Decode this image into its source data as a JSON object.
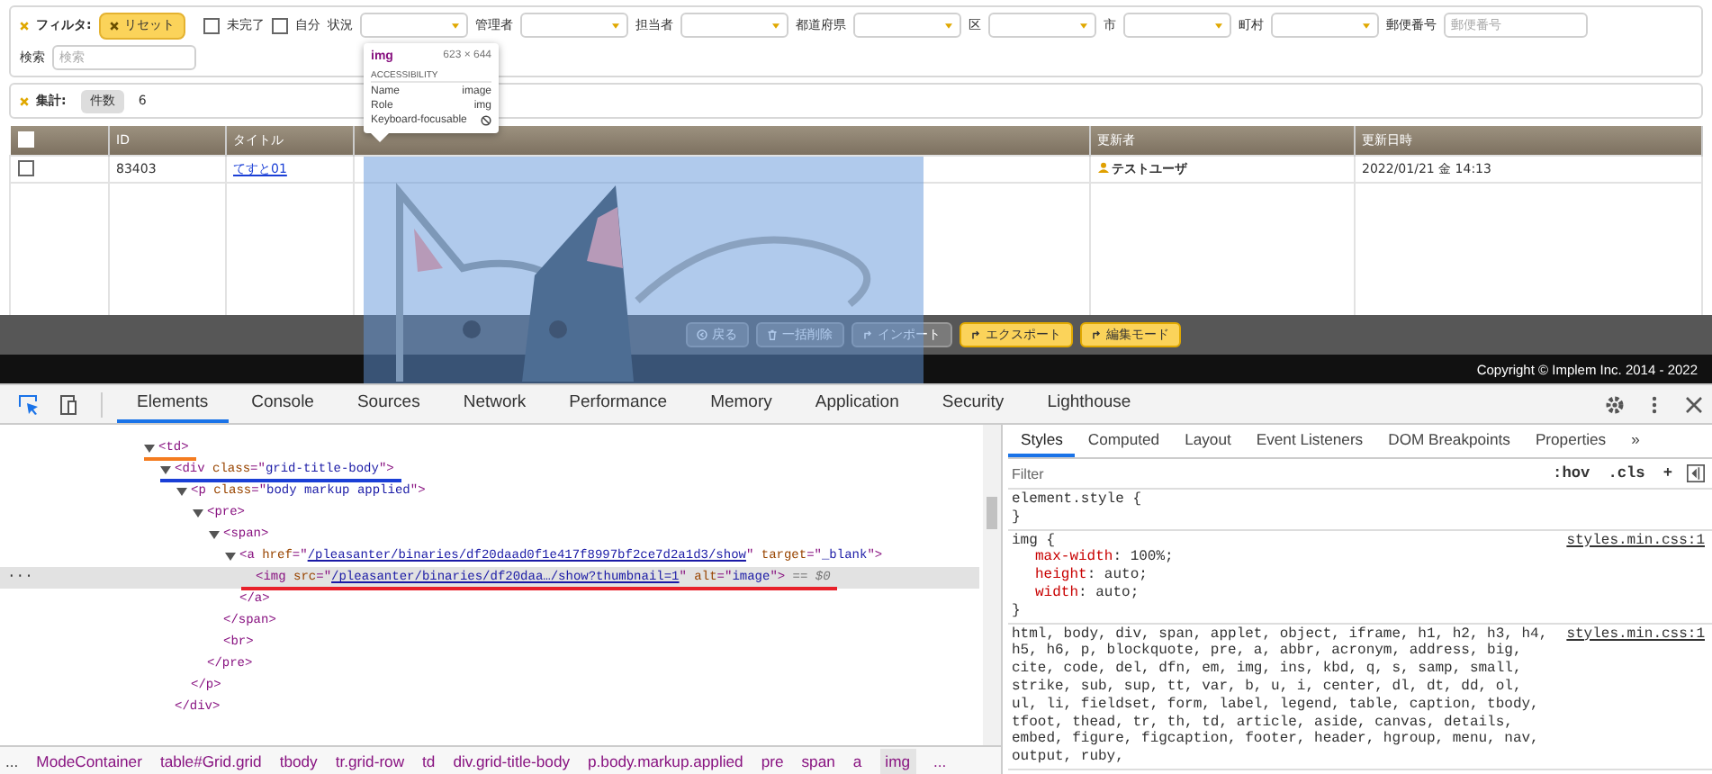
{
  "filter": {
    "label": "フィルタ:",
    "reset": "リセット",
    "checks": [
      {
        "label": "未完了",
        "checked": false
      },
      {
        "label": "自分",
        "checked": false
      }
    ],
    "selects": [
      {
        "label": "状況"
      },
      {
        "label": "管理者"
      },
      {
        "label": "担当者"
      },
      {
        "label": "都道府県"
      },
      {
        "label": "区"
      },
      {
        "label": "市"
      },
      {
        "label": "町村"
      }
    ],
    "postal": {
      "label": "郵便番号",
      "placeholder": "郵便番号"
    },
    "search": {
      "label": "検索",
      "placeholder": "検索"
    }
  },
  "summary": {
    "label": "集計:",
    "button": "件数",
    "value": "6"
  },
  "table": {
    "header_checked": false,
    "columns": [
      {
        "label": "ID"
      },
      {
        "label": "タイトル"
      },
      {},
      {
        "label": "更新者"
      },
      {
        "label": "更新日時"
      }
    ],
    "rows": [
      {
        "checked": false,
        "id": "83403",
        "title": "てすと01",
        "updated_by": "テストユーザ",
        "updated_at": "2022/01/21 金 14:13"
      }
    ]
  },
  "command_bar": [
    {
      "label": "戻る",
      "disabled": true
    },
    {
      "label": "一括削除",
      "disabled": true
    },
    {
      "label": "インポート",
      "disabled": true
    },
    {
      "label": "エクスポート",
      "disabled": false
    },
    {
      "label": "編集モード",
      "disabled": false
    }
  ],
  "footer": "Copyright © Implem Inc. 2014 - 2022",
  "tooltip": {
    "tag": "img",
    "size": "623 × 644",
    "section": "ACCESSIBILITY",
    "rows": [
      {
        "label": "Name",
        "value": "image"
      },
      {
        "label": "Role",
        "value": "img"
      },
      {
        "label": "Keyboard-focusable"
      }
    ]
  },
  "devtools": {
    "inspect_on": true,
    "tabs": [
      {
        "label": "Elements",
        "selected": true
      },
      {
        "label": "Console",
        "selected": false
      },
      {
        "label": "Sources",
        "selected": false
      },
      {
        "label": "Network",
        "selected": false
      },
      {
        "label": "Performance",
        "selected": false
      },
      {
        "label": "Memory",
        "selected": false
      },
      {
        "label": "Application",
        "selected": false
      },
      {
        "label": "Security",
        "selected": false
      },
      {
        "label": "Lighthouse",
        "selected": false
      }
    ],
    "row_menu": "···",
    "elements_tree": [
      {
        "open": [
          {
            "kind": "tag",
            "text": "<td>"
          }
        ],
        "expanded": true,
        "selected": false,
        "color": "#f47c20",
        "children": [
          {
            "open": [
              {
                "kind": "tag",
                "text": "<div"
              },
              {
                "kind": "attr",
                "text": " class"
              },
              {
                "kind": "punct",
                "text": "=\""
              },
              {
                "kind": "value",
                "text": "grid-title-body"
              },
              {
                "kind": "punct",
                "text": "\""
              },
              {
                "kind": "tag",
                "text": ">"
              }
            ],
            "expanded": true,
            "selected": false,
            "color": "#1a3fd6",
            "children": [
              {
                "open": [
                  {
                    "kind": "tag",
                    "text": "<p"
                  },
                  {
                    "kind": "attr",
                    "text": " class"
                  },
                  {
                    "kind": "punct",
                    "text": "=\""
                  },
                  {
                    "kind": "value",
                    "text": "body markup applied"
                  },
                  {
                    "kind": "punct",
                    "text": "\""
                  },
                  {
                    "kind": "tag",
                    "text": ">"
                  }
                ],
                "expanded": true,
                "selected": false,
                "children": [
                  {
                    "open": [
                      {
                        "kind": "tag",
                        "text": "<pre>"
                      }
                    ],
                    "expanded": true,
                    "selected": false,
                    "children": [
                      {
                        "open": [
                          {
                            "kind": "tag",
                            "text": "<span>"
                          }
                        ],
                        "expanded": true,
                        "selected": false,
                        "children": [
                          {
                            "open": [
                              {
                                "kind": "tag",
                                "text": "<a"
                              },
                              {
                                "kind": "attr",
                                "text": " href"
                              },
                              {
                                "kind": "punct",
                                "text": "=\""
                              },
                              {
                                "kind": "link",
                                "text": "/pleasanter/binaries/df20daad0f1e417f8997bf2ce7d2a1d3/show"
                              },
                              {
                                "kind": "punct",
                                "text": "\""
                              },
                              {
                                "kind": "attr",
                                "text": " target"
                              },
                              {
                                "kind": "punct",
                                "text": "=\""
                              },
                              {
                                "kind": "value",
                                "text": "_blank"
                              },
                              {
                                "kind": "punct",
                                "text": "\""
                              },
                              {
                                "kind": "tag",
                                "text": ">"
                              }
                            ],
                            "expanded": true,
                            "selected": false,
                            "children": [
                              {
                                "open": [
                                  {
                                    "kind": "tag",
                                    "text": "<img"
                                  },
                                  {
                                    "kind": "attr",
                                    "text": " src"
                                  },
                                  {
                                    "kind": "punct",
                                    "text": "=\""
                                  },
                                  {
                                    "kind": "link",
                                    "text": "/pleasanter/binaries/df20daa…/show?thumbnail=1"
                                  },
                                  {
                                    "kind": "punct",
                                    "text": "\""
                                  },
                                  {
                                    "kind": "attr",
                                    "text": " alt"
                                  },
                                  {
                                    "kind": "punct",
                                    "text": "=\""
                                  },
                                  {
                                    "kind": "value",
                                    "text": "image"
                                  },
                                  {
                                    "kind": "punct",
                                    "text": "\""
                                  },
                                  {
                                    "kind": "tag",
                                    "text": ">"
                                  },
                                  {
                                    "kind": "comment",
                                    "text": " == $0"
                                  }
                                ],
                                "selected": true,
                                "color": "#e8202a"
                              }
                            ],
                            "close": [
                              {
                                "kind": "tag",
                                "text": "</a>"
                              }
                            ]
                          }
                        ],
                        "close": [
                          {
                            "kind": "tag",
                            "text": "</span>"
                          }
                        ]
                      },
                      {
                        "open": [
                          {
                            "kind": "tag",
                            "text": "<br>"
                          }
                        ],
                        "selected": false
                      }
                    ],
                    "close": [
                      {
                        "kind": "tag",
                        "text": "</pre>"
                      }
                    ]
                  }
                ],
                "close": [
                  {
                    "kind": "tag",
                    "text": "</p>"
                  }
                ]
              }
            ],
            "close": [
              {
                "kind": "tag",
                "text": "</div>"
              }
            ]
          }
        ]
      }
    ],
    "breadcrumb": {
      "more_left": "...",
      "more_right": "...",
      "items": [
        {
          "label": "ModeContainer",
          "selected": false
        },
        {
          "label": "table#Grid.grid",
          "selected": false
        },
        {
          "label": "tbody",
          "selected": false
        },
        {
          "label": "tr.grid-row",
          "selected": false
        },
        {
          "label": "td",
          "selected": false
        },
        {
          "label": "div.grid-title-body",
          "selected": false
        },
        {
          "label": "p.body.markup.applied",
          "selected": false
        },
        {
          "label": "pre",
          "selected": false
        },
        {
          "label": "span",
          "selected": false
        },
        {
          "label": "a",
          "selected": false
        },
        {
          "label": "img",
          "selected": true
        }
      ]
    },
    "styles": {
      "tabs": [
        {
          "label": "Styles",
          "selected": true
        },
        {
          "label": "Computed",
          "selected": false
        },
        {
          "label": "Layout",
          "selected": false
        },
        {
          "label": "Event Listeners",
          "selected": false
        },
        {
          "label": "DOM Breakpoints",
          "selected": false
        },
        {
          "label": "Properties",
          "selected": false
        }
      ],
      "more_tabs": "»",
      "filter_placeholder": "Filter",
      "tools": [
        ":hov",
        ".cls",
        "+"
      ],
      "rules": [
        {
          "selector": "element.style {",
          "close": "}"
        },
        {
          "selector": "img {",
          "source": "styles.min.css:1",
          "declarations": [
            {
              "property": "max-width",
              "value": ": 100%;"
            },
            {
              "property": "height",
              "value": ": auto;"
            },
            {
              "property": "width",
              "value": ": auto;"
            }
          ],
          "close": "}"
        },
        {
          "selector": "html, body, div, span, applet, object, iframe, h1, h2, h3, h4, h5, h6, p, blockquote, pre, a, abbr, acronym, address, big, cite, code, del, dfn, em, img, ins, kbd, q, s, samp, small, strike, sub, sup, tt, var, b, u, i, center, dl, dt, dd, ol, ul, li, fieldset, form, label, legend, table, caption, tbody, tfoot, thead, tr, th, td, article, aside, canvas, details, embed, figure, figcaption, footer, header, hgroup, menu, nav, output, ruby,",
          "source": "styles.min.css:1"
        }
      ]
    }
  }
}
